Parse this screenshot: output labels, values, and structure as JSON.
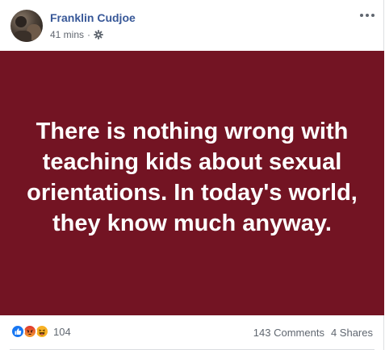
{
  "post": {
    "author": "Franklin Cudjoe",
    "time": "41 mins",
    "separator": "·",
    "privacy_icon": "gear-icon",
    "more_icon": "more-options-icon"
  },
  "card": {
    "text": "There is nothing wrong with teaching kids about sexual orientations. In today's world, they know much anyway.",
    "background_color": "#731423",
    "text_color": "#ffffff"
  },
  "footer": {
    "reaction_icons": [
      "like-icon",
      "angry-icon",
      "haha-icon"
    ],
    "reaction_count": "104",
    "comments": "143 Comments",
    "shares": "4 Shares"
  },
  "colors": {
    "author_link": "#385898",
    "meta_text": "#616770",
    "like_blue": "#1877f2",
    "angry_orange": "#e9710f",
    "haha_yellow": "#f7b125"
  }
}
